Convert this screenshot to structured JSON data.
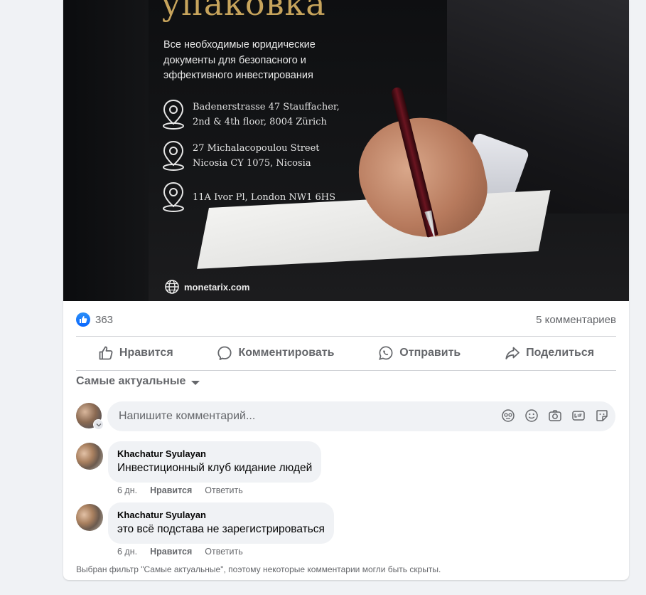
{
  "ad": {
    "headline": "упаковка",
    "tagline": "Все необходимые юридические документы для безопасного и эффективного инвестирования",
    "addresses": [
      "Badenerstrasse 47 Stauffacher,\n2nd & 4th floor, 8004 Zürich",
      "27 Michalacopoulou Street\nNicosia CY 1075, Nicosia",
      "11A Ivor Pl, London NW1 6HS"
    ],
    "website": "monetarix.com"
  },
  "reactions": {
    "likes_count": "363",
    "comments_count": "5 комментариев"
  },
  "actions": {
    "like": "Нравится",
    "comment": "Комментировать",
    "send": "Отправить",
    "share": "Поделиться"
  },
  "sort_label": "Самые актуальные",
  "composer": {
    "placeholder": "Напишите комментарий..."
  },
  "comments": [
    {
      "author": "Khachatur Syulayan",
      "text": "Инвестиционный клуб кидание людей",
      "time": "6 дн.",
      "like": "Нравится",
      "reply": "Ответить"
    },
    {
      "author": "Khachatur Syulayan",
      "text": "это всё подстава не зарегистрироваться",
      "time": "6 дн.",
      "like": "Нравится",
      "reply": "Ответить"
    }
  ],
  "filter_note": "Выбран фильтр \"Самые актуальные\", поэтому некоторые комментарии могли быть скрыты.",
  "colors": {
    "facebook_blue": "#0866ff",
    "secondary_text": "#65676b",
    "gold": "#c7a45c"
  }
}
